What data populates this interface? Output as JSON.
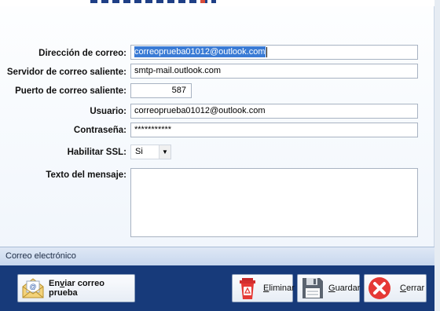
{
  "form": {
    "email": {
      "label": "Dirección de correo:",
      "value": "correoprueba01012@outlook.com"
    },
    "server": {
      "label": "Servidor de correo saliente:",
      "value": "smtp-mail.outlook.com"
    },
    "port": {
      "label": "Puerto de correo saliente:",
      "value": "587"
    },
    "user": {
      "label": "Usuario:",
      "value": "correoprueba01012@outlook.com"
    },
    "password": {
      "label": "Contraseña:",
      "value": "***********"
    },
    "ssl": {
      "label": "Habilitar SSL:",
      "value": "Si"
    },
    "message": {
      "label": "Texto del mensaje:",
      "value": ""
    }
  },
  "status": {
    "text": "Correo electrónico"
  },
  "buttons": {
    "test": {
      "label_pre": "En",
      "label_u": "v",
      "label_post": "iar correo prueba",
      "icon": "envelope-icon"
    },
    "delete": {
      "label_u": "E",
      "label_post": "liminar",
      "icon": "trash-icon"
    },
    "save": {
      "label_u": "G",
      "label_post": "uardar",
      "icon": "floppy-disk-icon"
    },
    "close": {
      "label_u": "C",
      "label_post": "errar",
      "icon": "close-circle-icon"
    }
  },
  "colors": {
    "button_bar": "#173a7a",
    "selection": "#3a7bd5",
    "close_red": "#e53935"
  }
}
